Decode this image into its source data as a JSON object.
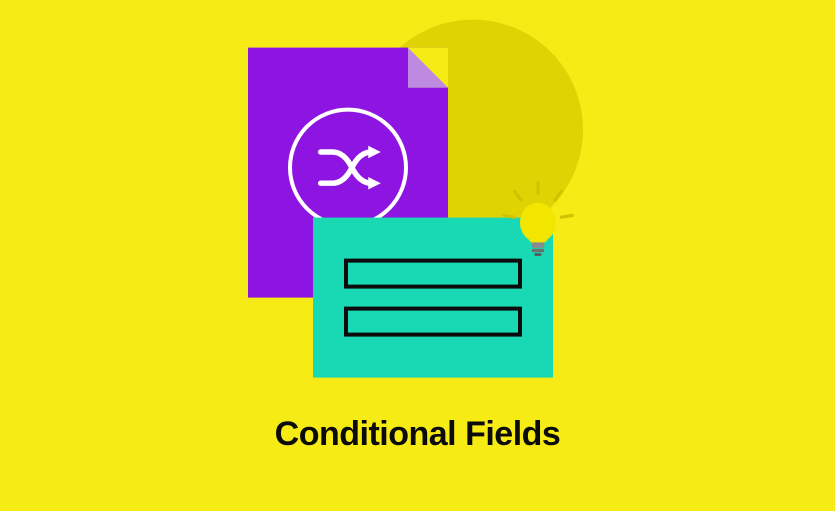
{
  "title": "Conditional Fields",
  "colors": {
    "background": "#f7eb15",
    "circle": "#dccf00",
    "document": "#8e14e2",
    "form_card": "#19d9b4",
    "text": "#0b0b0b"
  },
  "elements": {
    "document_icon": "shuffle",
    "form_fields_count": 2,
    "lightbulb_present": true
  }
}
